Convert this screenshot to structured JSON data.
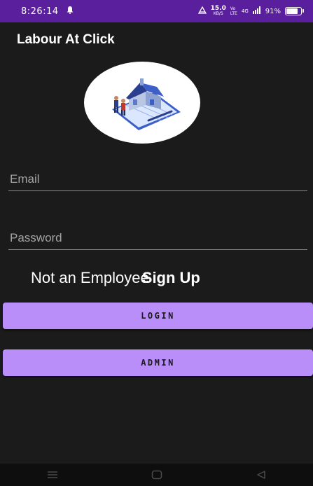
{
  "status_bar": {
    "time": "8:26:14",
    "net_speed": "15.0",
    "net_unit": "KB/S",
    "network_labels": "Vo LTE",
    "signal_label": "4G",
    "battery": "91%",
    "battery_level": 0.91,
    "notification_icon": "bell-icon"
  },
  "app": {
    "title": "Labour At Click"
  },
  "logo": {
    "icon": "house-blueprint-illustration"
  },
  "form": {
    "email_placeholder": "Email",
    "password_placeholder": "Password"
  },
  "signup": {
    "prompt": "Not an Employee",
    "link": "Sign Up"
  },
  "buttons": {
    "login": "LOGIN",
    "admin": "ADMIN"
  },
  "colors": {
    "status_bar": "#5a1f9d",
    "background": "#1b1b1b",
    "button": "#b98ef9",
    "underline": "#8a8a8a"
  },
  "nav": {
    "icons": [
      "menu-icon",
      "home-icon",
      "back-icon"
    ]
  }
}
